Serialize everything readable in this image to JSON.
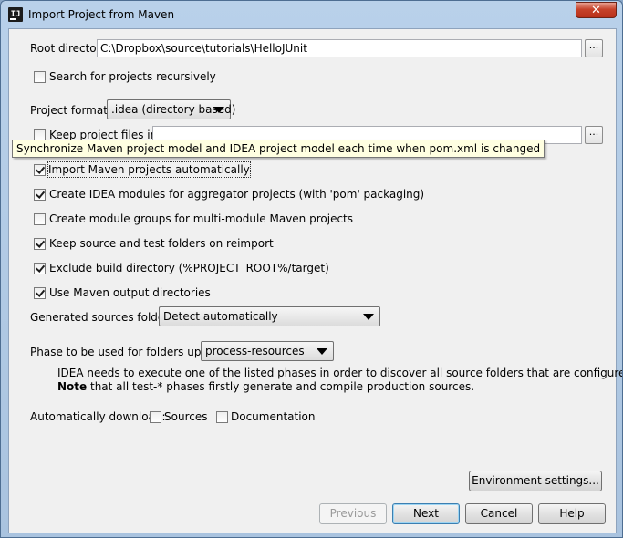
{
  "window": {
    "title": "Import Project from Maven",
    "close_symbol": "✕"
  },
  "root_directory": {
    "label": "Root directory",
    "value": "C:\\Dropbox\\source\\tutorials\\HelloJUnit",
    "browse_label": "..."
  },
  "search_recursively": {
    "label": "Search for projects recursively",
    "checked": false
  },
  "project_format": {
    "label": "Project format:",
    "value": ".idea (directory based)"
  },
  "keep_project_files": {
    "label": "Keep project files in:",
    "value": "",
    "browse_label": "...",
    "checked": false
  },
  "tooltip": {
    "text": "Synchronize Maven project model and IDEA project model each time when pom.xml is changed"
  },
  "options": [
    {
      "label": "Import Maven projects automatically",
      "checked": true
    },
    {
      "label": "Create IDEA modules for aggregator projects (with 'pom' packaging)",
      "checked": true
    },
    {
      "label": "Create module groups for multi-module Maven projects",
      "checked": false
    },
    {
      "label": "Keep source and test folders on reimport",
      "checked": true
    },
    {
      "label": "Exclude build directory (%PROJECT_ROOT%/target)",
      "checked": true
    },
    {
      "label": "Use Maven output directories",
      "checked": true
    }
  ],
  "generated_sources": {
    "label": "Generated sources folders:",
    "value": "Detect automatically"
  },
  "phase": {
    "label": "Phase to be used for folders update:",
    "value": "process-resources",
    "note_line1": "IDEA needs to execute one of the listed phases in order to discover all source folders that are configured via Maven plugins.",
    "note_bold": "Note",
    "note_line2_rest": " that all test-* phases firstly generate and compile production sources."
  },
  "auto_download": {
    "label": "Automatically download:",
    "sources_label": "Sources",
    "sources_checked": false,
    "documentation_label": "Documentation",
    "documentation_checked": false
  },
  "buttons": {
    "environment_settings": "Environment settings...",
    "previous": "Previous",
    "next": "Next",
    "cancel": "Cancel",
    "help": "Help"
  }
}
